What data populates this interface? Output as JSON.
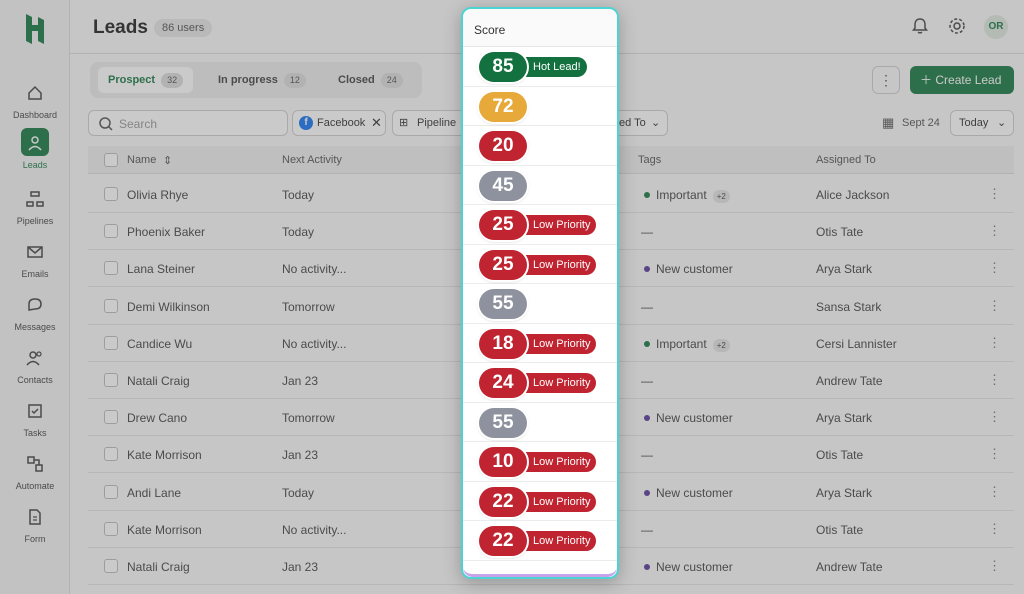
{
  "sidebar": {
    "items": [
      {
        "label": "Dashboard",
        "icon": "home-icon"
      },
      {
        "label": "Leads",
        "icon": "user-icon",
        "active": true
      },
      {
        "label": "Pipelines",
        "icon": "pipeline-icon"
      },
      {
        "label": "Emails",
        "icon": "mail-icon"
      },
      {
        "label": "Messages",
        "icon": "chat-icon"
      },
      {
        "label": "Contacts",
        "icon": "contacts-icon"
      },
      {
        "label": "Tasks",
        "icon": "tasks-icon"
      },
      {
        "label": "Automate",
        "icon": "automate-icon"
      },
      {
        "label": "Form",
        "icon": "form-icon"
      }
    ]
  },
  "header": {
    "title": "Leads",
    "users_badge": "86 users",
    "avatar_initials": "OR"
  },
  "tabs": [
    {
      "label": "Prospect",
      "count": "32"
    },
    {
      "label": "In progress",
      "count": "12"
    },
    {
      "label": "Closed",
      "count": "24"
    }
  ],
  "toolbar": {
    "create_label": "Create Lead",
    "create_icon": "plus-icon",
    "search_placeholder": "Search",
    "filter_facebook": "Facebook",
    "filter_pipeline": "Pipeline",
    "filter_assigned_fragment": "ed To",
    "date_label": "Sept 24",
    "today_label": "Today"
  },
  "table": {
    "columns": {
      "name": "Name",
      "next_activity": "Next Activity",
      "tags": "Tags",
      "assigned_to": "Assigned To"
    },
    "rows": [
      {
        "name": "Olivia Rhye",
        "next": "Today",
        "tag": "Important",
        "tag_extra": "+2",
        "tag_color": "#1a7a45",
        "assigned": "Alice Jackson"
      },
      {
        "name": "Phoenix Baker",
        "next": "Today",
        "tag": "—",
        "tag_extra": "",
        "tag_color": "",
        "assigned": "Otis Tate"
      },
      {
        "name": "Lana Steiner",
        "next": "No activity...",
        "tag": "New customer",
        "tag_extra": "",
        "tag_color": "#5b3a9e",
        "assigned": "Arya Stark"
      },
      {
        "name": "Demi Wilkinson",
        "next": "Tomorrow",
        "tag": "—",
        "tag_extra": "",
        "tag_color": "",
        "assigned": "Sansa Stark"
      },
      {
        "name": "Candice Wu",
        "next": "No activity...",
        "tag": "Important",
        "tag_extra": "+2",
        "tag_color": "#1a7a45",
        "assigned": "Cersi Lannister"
      },
      {
        "name": "Natali Craig",
        "next": "Jan 23",
        "tag": "—",
        "tag_extra": "",
        "tag_color": "",
        "assigned": "Andrew Tate"
      },
      {
        "name": "Drew Cano",
        "next": "Tomorrow",
        "tag": "New customer",
        "tag_extra": "",
        "tag_color": "#5b3a9e",
        "assigned": "Arya Stark"
      },
      {
        "name": "Kate Morrison",
        "next": "Jan 23",
        "tag": "—",
        "tag_extra": "",
        "tag_color": "",
        "assigned": "Otis Tate"
      },
      {
        "name": "Andi Lane",
        "next": "Today",
        "tag": "New customer",
        "tag_extra": "",
        "tag_color": "#5b3a9e",
        "assigned": "Arya Stark"
      },
      {
        "name": "Kate Morrison",
        "next": "No activity...",
        "tag": "—",
        "tag_extra": "",
        "tag_color": "",
        "assigned": "Otis Tate"
      },
      {
        "name": "Natali Craig",
        "next": "Jan 23",
        "tag": "New customer",
        "tag_extra": "",
        "tag_color": "#5b3a9e",
        "assigned": "Andrew Tate"
      }
    ]
  },
  "score": {
    "header": "Score",
    "colors": {
      "green": "#13703f",
      "yellow": "#e7a93a",
      "red": "#bf2430",
      "gray": "#8d929e"
    },
    "items": [
      {
        "value": "85",
        "color": "green",
        "label": "Hot Lead!"
      },
      {
        "value": "72",
        "color": "yellow",
        "label": ""
      },
      {
        "value": "20",
        "color": "red",
        "label": ""
      },
      {
        "value": "45",
        "color": "gray",
        "label": ""
      },
      {
        "value": "25",
        "color": "red",
        "label": "Low Priority"
      },
      {
        "value": "25",
        "color": "red",
        "label": "Low Priority"
      },
      {
        "value": "55",
        "color": "gray",
        "label": ""
      },
      {
        "value": "18",
        "color": "red",
        "label": "Low Priority"
      },
      {
        "value": "24",
        "color": "red",
        "label": "Low Priority"
      },
      {
        "value": "55",
        "color": "gray",
        "label": ""
      },
      {
        "value": "10",
        "color": "red",
        "label": "Low Priority"
      },
      {
        "value": "22",
        "color": "red",
        "label": "Low Priority"
      },
      {
        "value": "22",
        "color": "red",
        "label": "Low Priority"
      }
    ]
  }
}
